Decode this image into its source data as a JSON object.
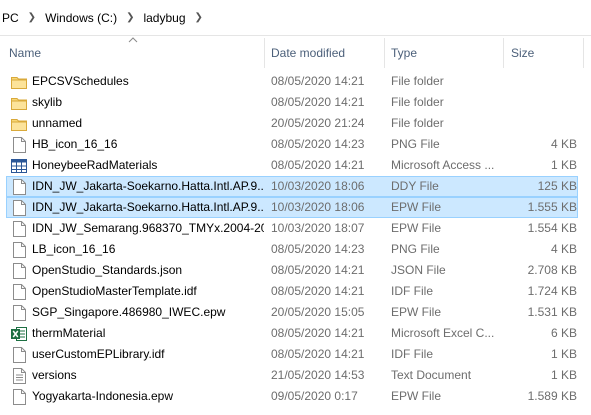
{
  "breadcrumb": [
    "PC",
    "Windows (C:)",
    "ladybug"
  ],
  "columns": {
    "name": "Name",
    "date": "Date modified",
    "type": "Type",
    "size": "Size"
  },
  "colors": {
    "accent": "#cce8ff",
    "folder": "#f8d775",
    "excel": "#1d6f42"
  },
  "files": [
    {
      "icon": "folder-icon",
      "name": "EPCSVSchedules",
      "date": "08/05/2020 14:21",
      "type": "File folder",
      "size": "",
      "selected": false
    },
    {
      "icon": "folder-icon",
      "name": "skylib",
      "date": "08/05/2020 14:21",
      "type": "File folder",
      "size": "",
      "selected": false
    },
    {
      "icon": "folder-icon",
      "name": "unnamed",
      "date": "20/05/2020 21:24",
      "type": "File folder",
      "size": "",
      "selected": false
    },
    {
      "icon": "file-icon",
      "name": "HB_icon_16_16",
      "date": "08/05/2020 14:23",
      "type": "PNG File",
      "size": "4 KB",
      "selected": false
    },
    {
      "icon": "access-icon",
      "name": "HoneybeeRadMaterials",
      "date": "08/05/2020 14:21",
      "type": "Microsoft Access ...",
      "size": "1 KB",
      "selected": false
    },
    {
      "icon": "file-icon",
      "name": "IDN_JW_Jakarta-Soekarno.Hatta.Intl.AP.9...",
      "date": "10/03/2020 18:06",
      "type": "DDY File",
      "size": "125 KB",
      "selected": true
    },
    {
      "icon": "file-icon",
      "name": "IDN_JW_Jakarta-Soekarno.Hatta.Intl.AP.9...",
      "date": "10/03/2020 18:06",
      "type": "EPW File",
      "size": "1.555 KB",
      "selected": true
    },
    {
      "icon": "file-icon",
      "name": "IDN_JW_Semarang.968370_TMYx.2004-20...",
      "date": "10/03/2020 18:07",
      "type": "EPW File",
      "size": "1.554 KB",
      "selected": false
    },
    {
      "icon": "file-icon",
      "name": "LB_icon_16_16",
      "date": "08/05/2020 14:23",
      "type": "PNG File",
      "size": "4 KB",
      "selected": false
    },
    {
      "icon": "file-icon",
      "name": "OpenStudio_Standards.json",
      "date": "08/05/2020 14:21",
      "type": "JSON File",
      "size": "2.708 KB",
      "selected": false
    },
    {
      "icon": "file-icon",
      "name": "OpenStudioMasterTemplate.idf",
      "date": "08/05/2020 14:21",
      "type": "IDF File",
      "size": "1.724 KB",
      "selected": false
    },
    {
      "icon": "file-icon",
      "name": "SGP_Singapore.486980_IWEC.epw",
      "date": "20/05/2020 15:05",
      "type": "EPW File",
      "size": "1.531 KB",
      "selected": false
    },
    {
      "icon": "excel-icon",
      "name": "thermMaterial",
      "date": "08/05/2020 14:21",
      "type": "Microsoft Excel C...",
      "size": "6 KB",
      "selected": false
    },
    {
      "icon": "file-icon",
      "name": "userCustomEPLibrary.idf",
      "date": "08/05/2020 14:21",
      "type": "IDF File",
      "size": "1 KB",
      "selected": false
    },
    {
      "icon": "text-file-icon",
      "name": "versions",
      "date": "21/05/2020 14:53",
      "type": "Text Document",
      "size": "1 KB",
      "selected": false
    },
    {
      "icon": "file-icon",
      "name": "Yogyakarta-Indonesia.epw",
      "date": "09/05/2020 0:17",
      "type": "EPW File",
      "size": "1.589 KB",
      "selected": false
    }
  ]
}
